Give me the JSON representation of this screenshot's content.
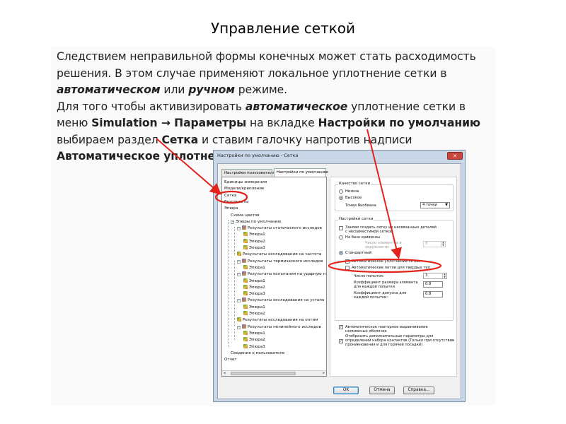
{
  "slide": {
    "title": "Управление сеткой",
    "para1_a": "Следствием неправильной формы конечных может стать расходимость решения. В этом случае применяют локальное уплотнение сетки в ",
    "para1_auto": "автоматическом",
    "para1_or": " или ",
    "para1_manual": "ручном",
    "para1_end": " режиме.",
    "para2_a": "Для того чтобы активизировать ",
    "para2_auto": "автоматическое",
    "para2_b": " уплотнение сетки в меню ",
    "para2_sim": "Simulation → Параметры",
    "para2_c": " на вкладке ",
    "para2_tab": "Настройки по умолчанию",
    "para2_d": " выбираем раздел ",
    "para2_mesh": "Сетка",
    "para2_e": " и ставим галочку напротив надписи ",
    "para2_check": "Автоматическое уплотнение сетки."
  },
  "dialog": {
    "title": "Настройки по умолчанию - Сетка",
    "close_glyph": "✕",
    "tabs": [
      "Настройки пользователя",
      "Настройки по умолчанию"
    ],
    "tree": [
      "Единицы измерения",
      "Модели/крепление",
      "Сетка",
      "Результаты",
      "Эпюра",
      "Схема цветов",
      "Эпюры по умолчанию",
      "Результаты статического исследов",
      "Эпюра1",
      "Эпюра2",
      "Эпюра3",
      "Результаты исследования на частота",
      "Результаты термического исследов",
      "Эпюра1",
      "Результаты испытания на ударную н",
      "Эпюра1",
      "Эпюра2",
      "Эпюра3",
      "Результаты исследования на устало",
      "Эпюра1",
      "Эпюра2",
      "Результаты исследования на оптим",
      "Результаты нелинейного исследов",
      "Эпюра1",
      "Эпюра2",
      "Эпюра3",
      "Сведения о пользователе",
      "Отчет"
    ],
    "quality": {
      "group": "Качество сетки",
      "low": "Низкое",
      "high": "Высокое",
      "jacobian_label": "Точки Якобиана",
      "jacobian_value": "4 точки"
    },
    "mesh_settings": {
      "group": "Настройки сетки",
      "redo_mesh": "Заново создать сетку из несвязанных деталей с несовместимой сеткой",
      "curvature": "На базе кривизны",
      "elements_in_circle": "Число элементов в окружности",
      "elements_value": "8",
      "standard": "Стандартный",
      "auto_refine": "Автоматическое уплотнение сетки",
      "auto_loops": "Автоматические петли для твердых тел",
      "attempts_label": "Число попыток:",
      "attempts_value": "3",
      "size_factor_label": "Коэффициент размера элемента для каждой попытки",
      "size_factor_value": "0.8",
      "tolerance_label": "Коэффициент допуска для каждой попытки:",
      "tolerance_value": "0.8"
    },
    "auto_realign": "Автоматическое повторное выравнивание несмежных оболочек",
    "show_extra": "Отобразить дополнительные параметры для определений набора контактов (Только при отсутствии проникновения и для горячей посадки)",
    "buttons": {
      "ok": "OK",
      "cancel": "Отмена",
      "help": "Справка..."
    },
    "check_glyph": "✓",
    "spin_glyphs": [
      "▲",
      "▼"
    ],
    "select_glyph": "▼",
    "expander_glyph": "−",
    "scroll_glyphs": [
      "◂",
      "▸"
    ]
  },
  "colors": {
    "annotation": "#e3231b",
    "accent": "#3c7fb1"
  }
}
